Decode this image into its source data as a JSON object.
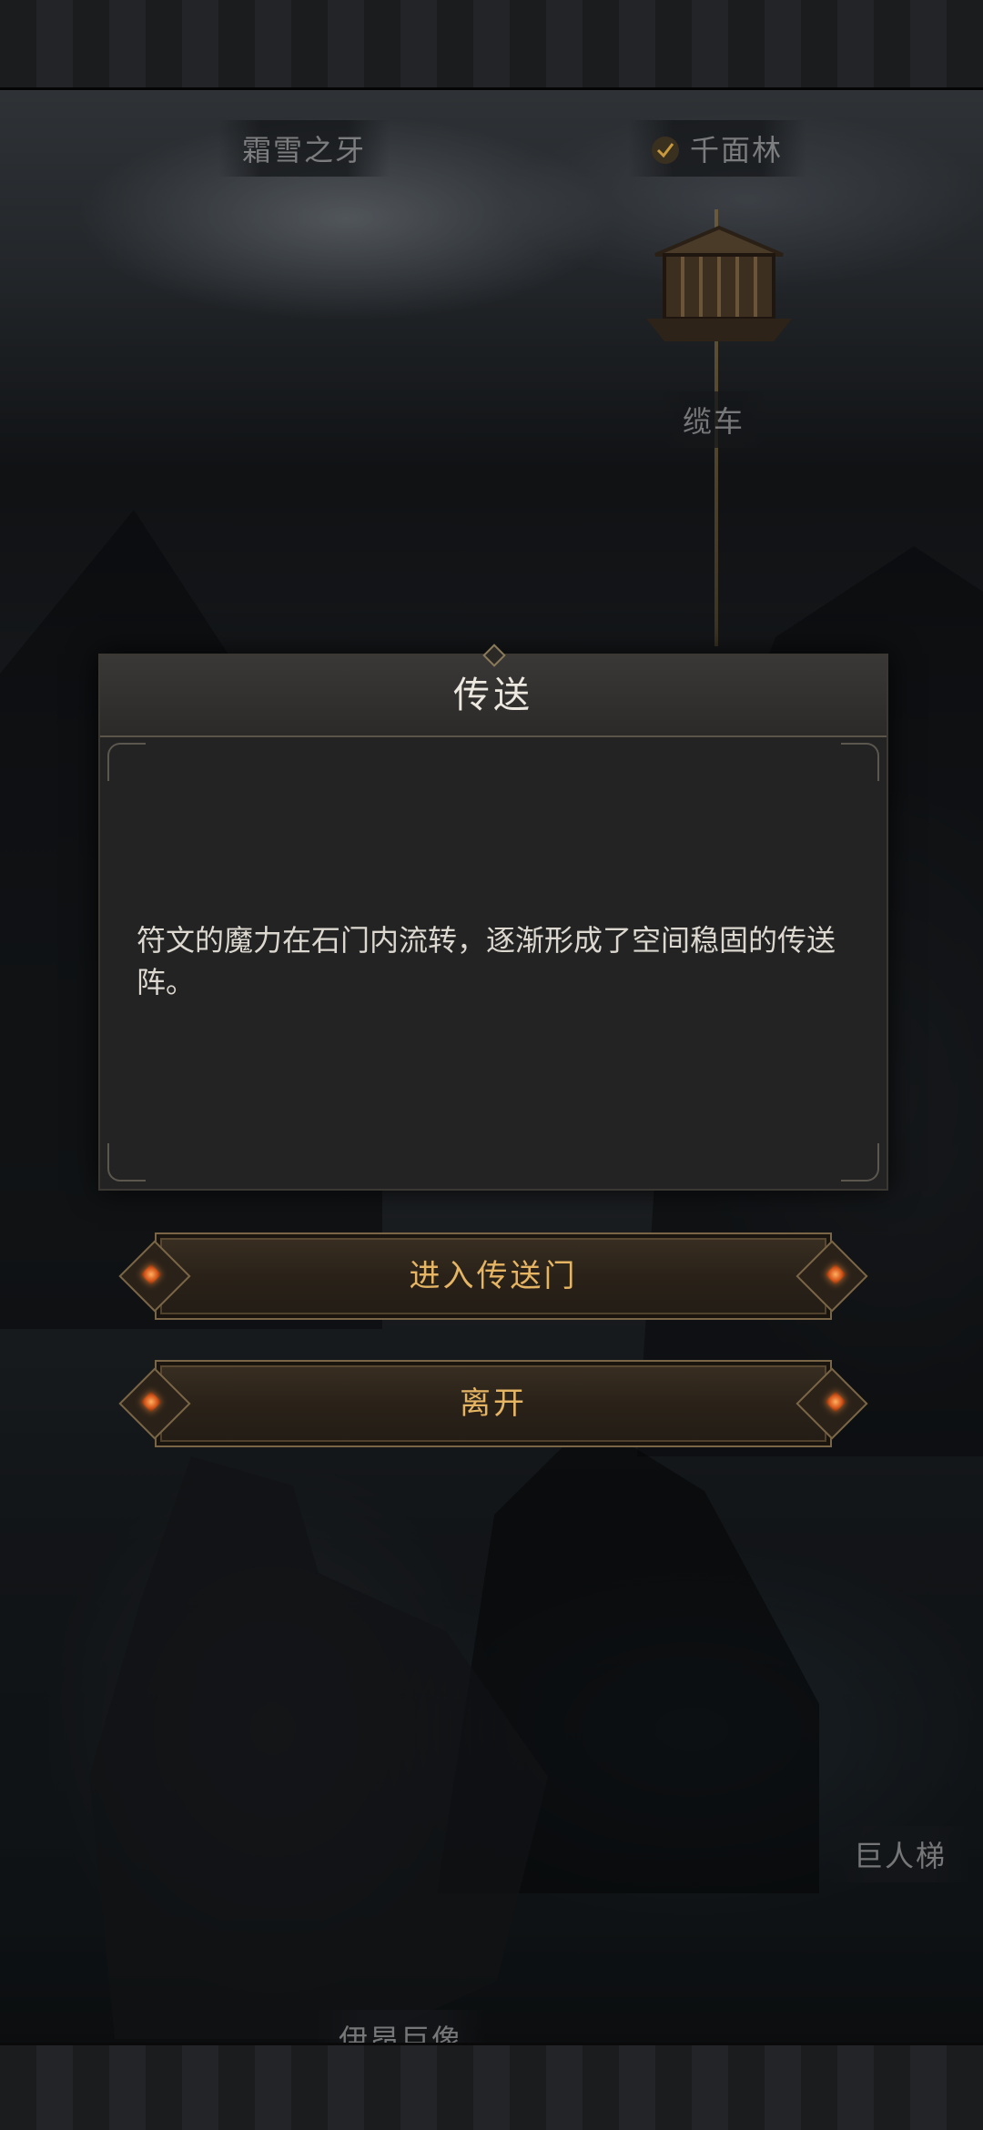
{
  "map": {
    "locations": {
      "frost_fang": "霜雪之牙",
      "thousand_faces_forest": "千面林",
      "cable_car": "缆车",
      "giant_ladder": "巨人梯",
      "colossus": "伊昂巨像"
    },
    "completed_marker": "check-icon"
  },
  "dialog": {
    "title": "传送",
    "body": "符文的魔力在石门内流转，逐渐形成了空间稳固的传送阵。"
  },
  "actions": {
    "enter_portal": "进入传送门",
    "leave": "离开"
  },
  "colors": {
    "button_text": "#e6b564",
    "dialog_bg": "#232323",
    "gem": "#d6561a"
  }
}
